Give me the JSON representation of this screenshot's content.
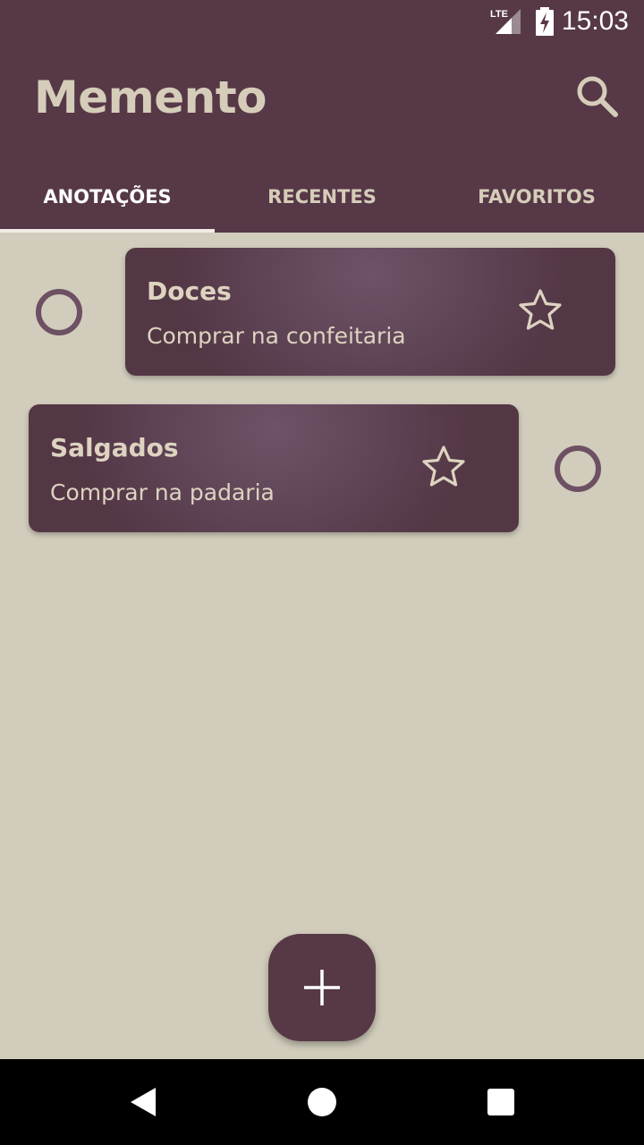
{
  "status_bar": {
    "network": "LTE",
    "time": "15:03",
    "icons": [
      "lte-signal-icon",
      "battery-charging-icon"
    ]
  },
  "app": {
    "title": "Memento",
    "search_icon": "search-icon"
  },
  "tabs": [
    {
      "label": "ANOTAÇÕES",
      "active": true
    },
    {
      "label": "RECENTES",
      "active": false
    },
    {
      "label": "FAVORITOS",
      "active": false
    }
  ],
  "notes": [
    {
      "title": "Doces",
      "description": "Comprar na confeitaria",
      "favorite": false
    },
    {
      "title": "Salgados",
      "description": "Comprar na padaria",
      "favorite": false
    }
  ],
  "fab": {
    "icon": "plus-icon"
  },
  "nav": {
    "icons": [
      "back-icon",
      "home-icon",
      "recents-icon"
    ]
  },
  "colors": {
    "primary": "#563846",
    "background": "#d1ccbb",
    "accent_text": "#d5cdb9",
    "ring": "#6d5063"
  }
}
